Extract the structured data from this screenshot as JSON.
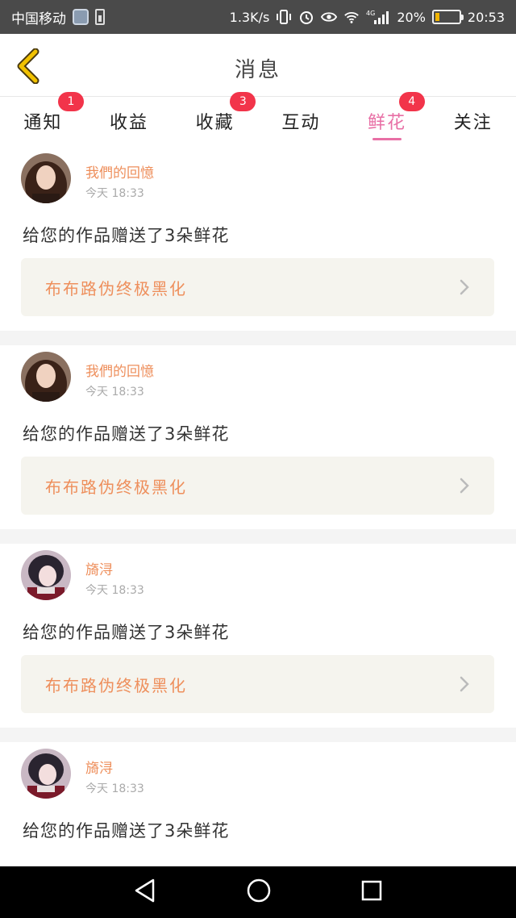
{
  "status_bar": {
    "carrier": "中国移动",
    "network_speed": "1.3K/s",
    "network_type": "4G",
    "battery_percent": "20%",
    "time": "20:53",
    "battery_level": 0.2,
    "battery_color": "#f0b400"
  },
  "header": {
    "title": "消息",
    "back_icon": "chevron-left-icon",
    "back_color": "#f2c200"
  },
  "tabs": [
    {
      "label": "通知",
      "badge": "1",
      "active": false
    },
    {
      "label": "收益",
      "badge": "",
      "active": false
    },
    {
      "label": "收藏",
      "badge": "3",
      "active": false
    },
    {
      "label": "互动",
      "badge": "",
      "active": false
    },
    {
      "label": "鲜花",
      "badge": "4",
      "active": true
    },
    {
      "label": "关注",
      "badge": "",
      "active": false
    }
  ],
  "colors": {
    "accent_pink": "#e86fa5",
    "username_orange": "#ee8f5c",
    "badge_red": "#f2344a"
  },
  "feed": [
    {
      "username": "我們的回憶",
      "time": "今天 18:33",
      "message": "给您的作品赠送了3朵鲜花",
      "work_title": "布布路伪终极黑化"
    },
    {
      "username": "我們的回憶",
      "time": "今天 18:33",
      "message": "给您的作品赠送了3朵鲜花",
      "work_title": "布布路伪终极黑化"
    },
    {
      "username": "旖浔",
      "time": "今天 18:33",
      "message": "给您的作品赠送了3朵鲜花",
      "work_title": "布布路伪终极黑化"
    },
    {
      "username": "旖浔",
      "time": "今天 18:33",
      "message": "给您的作品赠送了3朵鲜花",
      "work_title": ""
    }
  ],
  "nav_bar": {
    "back_icon": "triangle-back-icon",
    "home_icon": "circle-home-icon",
    "recents_icon": "square-recents-icon"
  }
}
